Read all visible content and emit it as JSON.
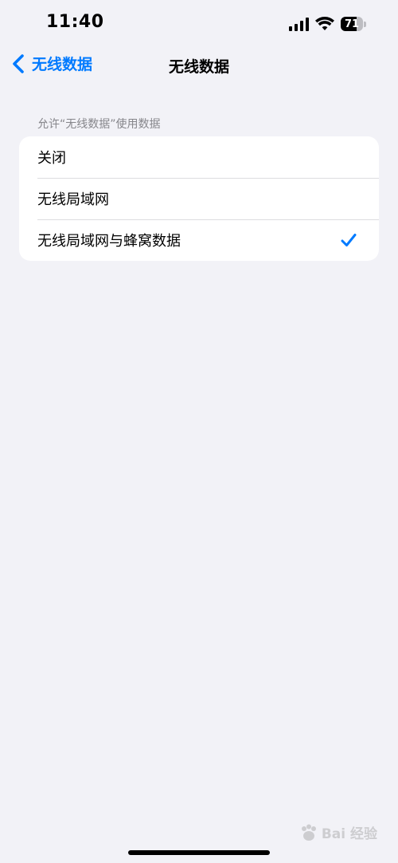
{
  "status_bar": {
    "time": "11:40",
    "battery_level": "71",
    "icons": [
      "cellular-signal-icon",
      "wifi-icon",
      "battery-icon"
    ]
  },
  "nav": {
    "back_label": "无线数据",
    "title": "无线数据"
  },
  "section": {
    "header": "允许“无线数据”使用数据",
    "options": [
      {
        "label": "关闭",
        "selected": false
      },
      {
        "label": "无线局域网",
        "selected": false
      },
      {
        "label": "无线局域网与蜂窝数据",
        "selected": true
      }
    ]
  },
  "watermark": {
    "text": "Bai 经验"
  },
  "colors": {
    "accent": "#007aff",
    "background": "#f2f2f7",
    "card": "#ffffff",
    "secondary_text": "#86868b"
  }
}
